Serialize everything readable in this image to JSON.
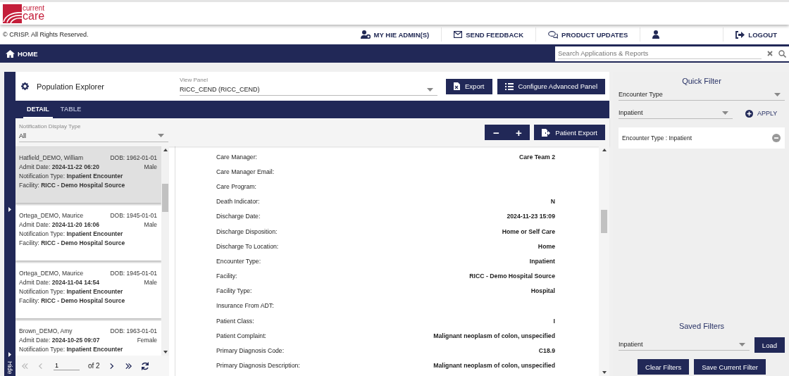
{
  "logo": {
    "line1": "current",
    "line2": "care"
  },
  "copyright": "© CRISP. All Rights Reserved.",
  "nav": [
    {
      "kind": "admin",
      "label": "MY HIE ADMIN(S)"
    },
    {
      "kind": "mail",
      "label": "SEND FEEDBACK"
    },
    {
      "kind": "chat",
      "label": "PRODUCT UPDATES"
    },
    {
      "kind": "user"
    },
    {
      "kind": "logout",
      "label": "LOGOUT"
    }
  ],
  "home": "HOME",
  "search": {
    "placeholder": "Search Applications & Reports"
  },
  "sidebar": {
    "hide": "Hide"
  },
  "module": {
    "title": "Population Explorer",
    "view_panel": {
      "label": "View Panel",
      "value": "RICC_CEND (RICC_CEND)"
    },
    "buttons": [
      {
        "kind": "export",
        "label": "Export"
      },
      {
        "kind": "configure",
        "label": "Configure Advanced Panel"
      }
    ]
  },
  "tabs": [
    {
      "label": "DETAIL",
      "selected": true
    },
    {
      "label": "TABLE",
      "selected": false
    }
  ],
  "display_type": {
    "label": "Notification Display Type",
    "value": "All"
  },
  "zoom_buttons": [
    "−",
    "+"
  ],
  "patient_export": "Patient Export",
  "patients": [
    {
      "name": "Hatfield_DEMO, William",
      "dob": "DOB: 1962-01-01",
      "admit": "Admit Date: **2024-11-22 06:20**",
      "gender": "Male",
      "notification": "Notification Type: **Inpatient Encounter**",
      "facility": "Facility: **RICC - Demo Hospital Source**",
      "selected": true
    },
    {
      "name": "Ortega_DEMO, Maurice",
      "dob": "DOB: 1945-01-01",
      "admit": "Admit Date: **2024-11-20 16:06**",
      "gender": "Male",
      "notification": "Notification Type: **Inpatient Encounter**",
      "facility": "Facility: **RICC - Demo Hospital Source**",
      "selected": false
    },
    {
      "name": "Ortega_DEMO, Maurice",
      "dob": "DOB: 1945-01-01",
      "admit": "Admit Date: **2024-11-04 14:54**",
      "gender": "Male",
      "notification": "Notification Type: **Inpatient Encounter**",
      "facility": "Facility: **RICC - Demo Hospital Source**",
      "selected": false
    },
    {
      "name": "Brown_DEMO, Amy",
      "dob": "DOB: 1963-01-01",
      "admit": "Admit Date: **2024-10-25 09:07**",
      "gender": "Female",
      "notification": "Notification Type: **Inpatient Encounter**",
      "selected": false
    }
  ],
  "pager": {
    "buttons": [
      {
        "kind": "first",
        "disabled": true
      },
      {
        "kind": "prev",
        "disabled": true
      },
      {
        "kind": "next",
        "disabled": false
      },
      {
        "kind": "last",
        "disabled": false
      }
    ],
    "page": "1",
    "of": "of 2"
  },
  "details": [
    {
      "label": "Care Manager:",
      "value": "Care Team 2"
    },
    {
      "label": "Care Manager Email:"
    },
    {
      "label": "Care Program:"
    },
    {
      "label": "Death Indicator:",
      "value": "N"
    },
    {
      "label": "Discharge Date:",
      "value": "2024-11-23 15:09"
    },
    {
      "label": "Discharge Disposition:",
      "value": "Home or Self Care"
    },
    {
      "label": "Discharge To Location:",
      "value": "Home"
    },
    {
      "label": "Encounter Type:",
      "value": "Inpatient"
    },
    {
      "label": "Facility:",
      "value": "RICC - Demo Hospital Source"
    },
    {
      "label": "Facility Type:",
      "value": "Hospital"
    },
    {
      "label": "Insurance From ADT:"
    },
    {
      "label": "Patient Class:",
      "value": "I"
    },
    {
      "label": "Patient Complaint:",
      "value": "Malignant neoplasm of colon, unspecified"
    },
    {
      "label": "Primary Diagnosis Code:",
      "value": "C18.9"
    },
    {
      "label": "Primary Diagnosis Description:",
      "value": "Malignant neoplasm of colon, unspecified"
    }
  ],
  "quick_filter": {
    "title": "Quick Filter",
    "field": "Encounter Type",
    "value": "Inpatient",
    "apply": "APPLY",
    "chips": [
      "Encounter Type : Inpatient"
    ]
  },
  "saved_filters": {
    "title": "Saved Filters",
    "value": "Inpatient",
    "load": "Load",
    "buttons": [
      "Clear Filters",
      "Save Current Filter"
    ]
  }
}
